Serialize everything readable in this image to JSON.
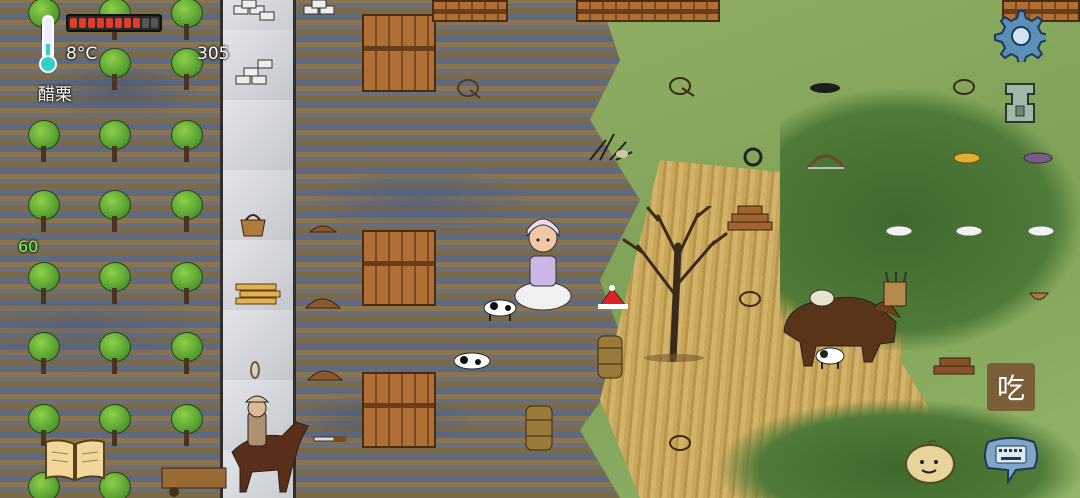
{
  "hud": {
    "temperature": "8°C",
    "yum_count": "305",
    "held_food": "醋栗",
    "fps": "60",
    "hunger": {
      "filled": 8,
      "total": 10
    },
    "eat_label": "吃"
  },
  "icons": {
    "thermometer": "thermometer-icon",
    "settings": "gear-icon",
    "tech_tree": "coin-icon",
    "recipe_book": "book-icon",
    "keyboard": "keyboard-icon",
    "emote": "potato-face-icon"
  },
  "colors": {
    "hunger_fill": "#e23b2a",
    "fps_text": "#7cff5a",
    "eat_button_bg": "#785032"
  }
}
